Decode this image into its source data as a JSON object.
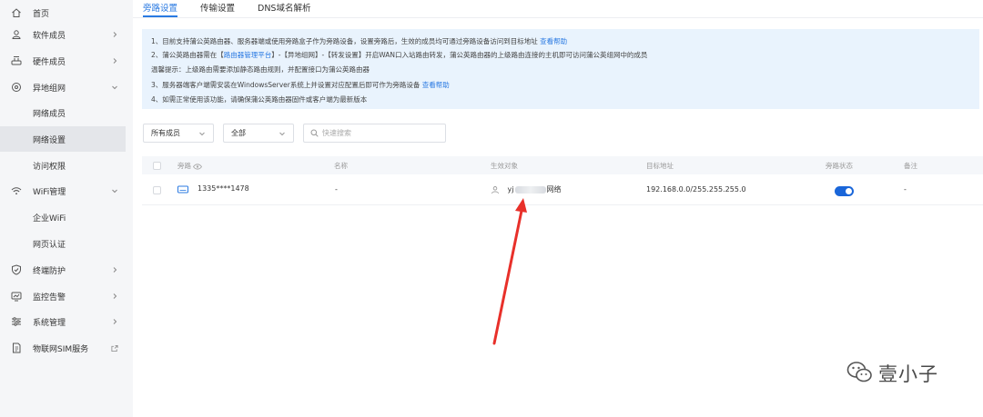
{
  "sidebar": {
    "items": [
      {
        "label": "首页",
        "icon": "home-icon"
      },
      {
        "label": "软件成员",
        "icon": "user-icon"
      },
      {
        "label": "硬件成员",
        "icon": "router-icon"
      },
      {
        "label": "异地组网",
        "icon": "network-icon"
      },
      {
        "label": "网络成员"
      },
      {
        "label": "网络设置"
      },
      {
        "label": "访问权限"
      },
      {
        "label": "WiFi管理",
        "icon": "wifi-icon"
      },
      {
        "label": "企业WiFi"
      },
      {
        "label": "网页认证"
      },
      {
        "label": "终端防护",
        "icon": "shield-icon"
      },
      {
        "label": "监控告警",
        "icon": "monitor-icon"
      },
      {
        "label": "系统管理",
        "icon": "settings-icon"
      },
      {
        "label": "物联网SIM服务",
        "icon": "sim-icon"
      }
    ]
  },
  "tabs": [
    {
      "label": "旁路设置"
    },
    {
      "label": "传输设置"
    },
    {
      "label": "DNS域名解析"
    }
  ],
  "info": {
    "line1": "1、目前支持蒲公英路由器、服务器端或使用旁路盒子作为旁路设备，设置旁路后，生效的成员均可通过旁路设备访问到目标地址",
    "line1_link": "查看帮助",
    "line2a": "2、蒲公英路由器需在【",
    "line2_link": "路由器管理平台",
    "line2b": "】-【异地组网】-【转发设置】开启WAN口入站路由转发，蒲公英路由器的上级路由连接的主机即可访问蒲公英组网中的成员",
    "line_tip": "温馨提示：上级路由需要添加静态路由规则，并配置接口为蒲公英路由器",
    "line3": "3、服务器端客户端需安装在WindowsServer系统上并设置对应配置后即可作为旁路设备",
    "line3_link": "查看帮助",
    "line4": "4、如需正常使用该功能，请确保蒲公英路由器固件或客户端为最新版本"
  },
  "filters": {
    "members": "所有成员",
    "status": "全部",
    "search_placeholder": "快速搜索"
  },
  "table": {
    "headers": {
      "bypass": "旁路",
      "name": "名称",
      "target": "生效对象",
      "address": "目标地址",
      "state": "旁路状态",
      "note": "备注"
    },
    "row": {
      "bypass": "1335****1478",
      "name": "-",
      "target_prefix": "yj",
      "target_suffix": "网络",
      "address": "192.168.0.0/255.255.255.0",
      "state_on": true,
      "note": "-"
    }
  },
  "watermark": {
    "text": "壹小子"
  },
  "colors": {
    "accent": "#2a7ae2",
    "toggle": "#1a66d9",
    "info_bg": "#e9f3fd",
    "arrow": "#e8302a"
  }
}
